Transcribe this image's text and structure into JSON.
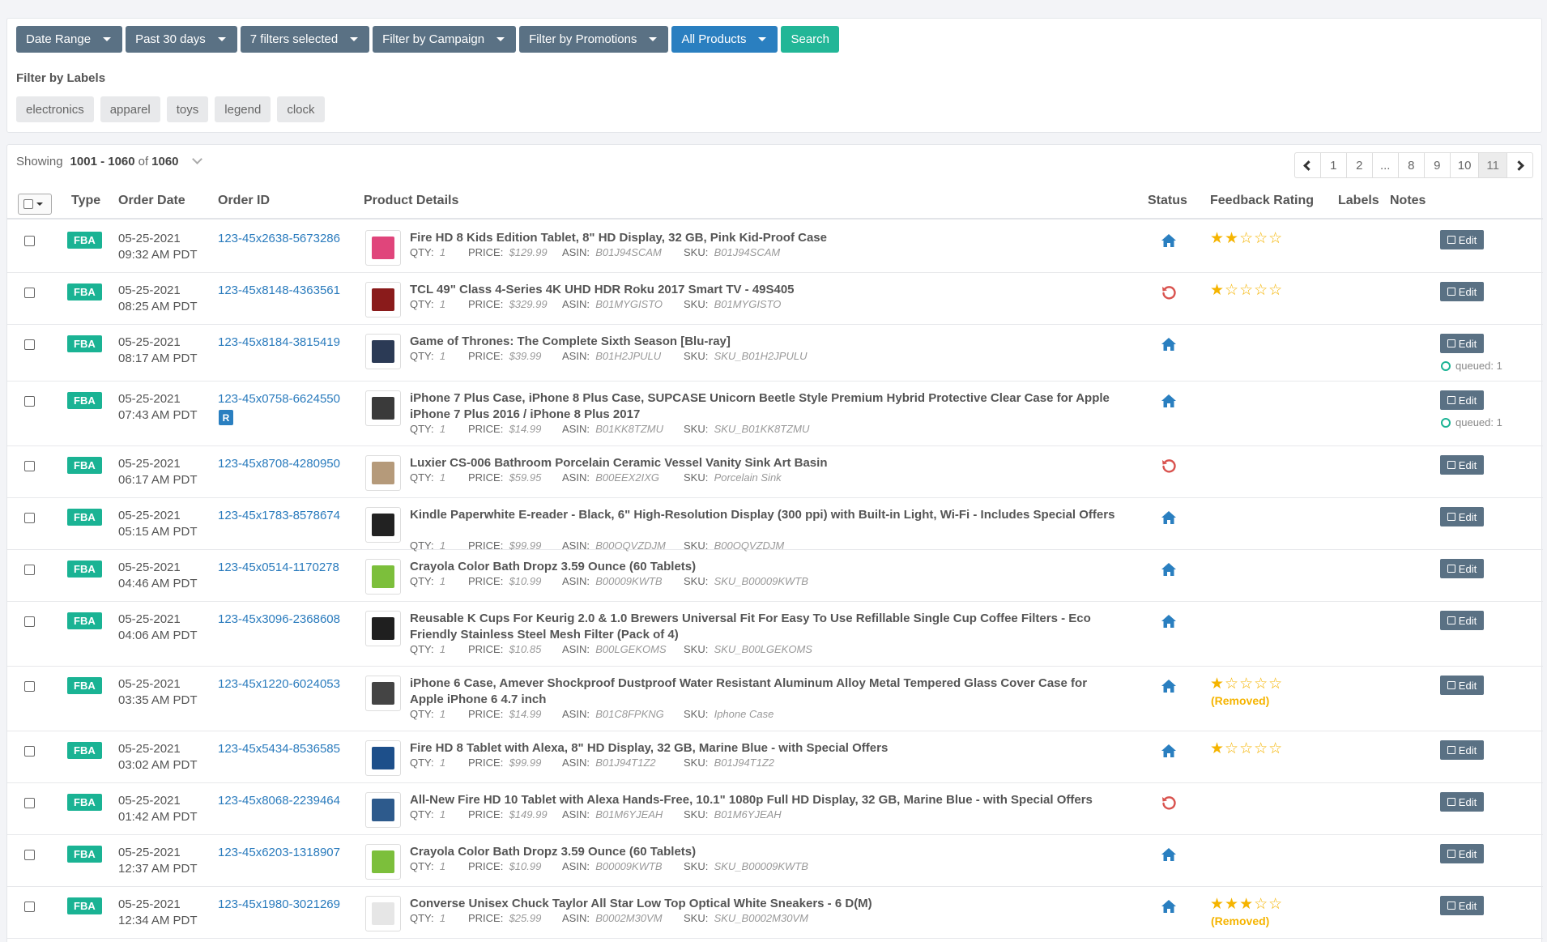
{
  "filters": {
    "buttons": [
      "Date Range",
      "Past 30 days",
      "7 filters selected",
      "Filter by Campaign",
      "Filter by Promotions",
      "All Products"
    ],
    "search_label": "Search",
    "labels_title": "Filter by Labels",
    "labels": [
      "electronics",
      "apparel",
      "toys",
      "legend",
      "clock"
    ]
  },
  "summary": {
    "showing_label": "Showing",
    "range": "1001 - 1060",
    "of_label": "of",
    "total": "1060"
  },
  "pagination": {
    "pages": [
      "1",
      "2",
      "...",
      "8",
      "9",
      "10",
      "11"
    ],
    "active": "11"
  },
  "table": {
    "headers": {
      "type": "Type",
      "order_date": "Order Date",
      "order_id": "Order ID",
      "product": "Product Details",
      "status": "Status",
      "feedback": "Feedback Rating",
      "labels": "Labels",
      "notes": "Notes"
    },
    "meta_labels": {
      "qty": "QTY:",
      "price": "PRICE:",
      "asin": "ASIN:",
      "sku": "SKU:"
    },
    "edit_label": "Edit",
    "rows": [
      {
        "type": "FBA",
        "date": "05-25-2021",
        "time": "09:32 AM PDT",
        "order_id": "123-45x2638-5673286",
        "title": "Fire HD 8 Kids Edition Tablet, 8\" HD Display, 32 GB, Pink Kid-Proof Case",
        "qty": "1",
        "price": "$129.99",
        "asin": "B01J94SCAM",
        "sku": "B01J94SCAM",
        "status": "home-icon",
        "stars": 2,
        "removed": "",
        "queued": "",
        "r": false,
        "thumb_color": "#e0457b"
      },
      {
        "type": "FBA",
        "date": "05-25-2021",
        "time": "08:25 AM PDT",
        "order_id": "123-45x8148-4363561",
        "title": "TCL 49\" Class 4-Series 4K UHD HDR Roku 2017 Smart TV - 49S405",
        "qty": "1",
        "price": "$329.99",
        "asin": "B01MYGISTO",
        "sku": "B01MYGISTO",
        "status": "return-icon",
        "stars": 1,
        "removed": "",
        "queued": "",
        "r": false,
        "thumb_color": "#8a1b1b"
      },
      {
        "type": "FBA",
        "date": "05-25-2021",
        "time": "08:17 AM PDT",
        "order_id": "123-45x8184-3815419",
        "title": "Game of Thrones: The Complete Sixth Season [Blu-ray]",
        "qty": "1",
        "price": "$39.99",
        "asin": "B01H2JPULU",
        "sku": "SKU_B01H2JPULU",
        "status": "home-icon",
        "stars": 0,
        "removed": "",
        "queued": "queued: 1",
        "r": false,
        "thumb_color": "#2b3a55"
      },
      {
        "type": "FBA",
        "date": "05-25-2021",
        "time": "07:43 AM PDT",
        "order_id": "123-45x0758-6624550",
        "title": "iPhone 7 Plus Case, iPhone 8 Plus Case, SUPCASE Unicorn Beetle Style Premium Hybrid Protective Clear Case for Apple iPhone 7 Plus 2016 / iPhone 8 Plus 2017",
        "qty": "1",
        "price": "$14.99",
        "asin": "B01KK8TZMU",
        "sku": "SKU_B01KK8TZMU",
        "status": "home-icon",
        "stars": 0,
        "removed": "",
        "queued": "queued: 1",
        "r": true,
        "r_label": "R",
        "thumb_color": "#3a3a3a"
      },
      {
        "type": "FBA",
        "date": "05-25-2021",
        "time": "06:17 AM PDT",
        "order_id": "123-45x8708-4280950",
        "title": "Luxier CS-006 Bathroom Porcelain Ceramic Vessel Vanity Sink Art Basin",
        "qty": "1",
        "price": "$59.95",
        "asin": "B00EEX2IXG",
        "sku": "Porcelain Sink",
        "status": "return-icon",
        "stars": 0,
        "removed": "",
        "queued": "",
        "r": false,
        "thumb_color": "#b59a7a"
      },
      {
        "type": "FBA",
        "date": "05-25-2021",
        "time": "05:15 AM PDT",
        "order_id": "123-45x1783-8578674",
        "title": "Kindle Paperwhite E-reader - Black, 6\" High-Resolution Display (300 ppi) with Built-in Light, Wi-Fi - Includes Special Offers",
        "qty": "1",
        "price": "$99.99",
        "asin": "B00OQVZDJM",
        "sku": "B00OQVZDJM",
        "status": "home-icon",
        "stars": 0,
        "removed": "",
        "queued": "",
        "r": false,
        "thumb_color": "#222222"
      },
      {
        "type": "FBA",
        "date": "05-25-2021",
        "time": "04:46 AM PDT",
        "order_id": "123-45x0514-1170278",
        "title": "Crayola Color Bath Dropz 3.59 Ounce (60 Tablets)",
        "qty": "1",
        "price": "$10.99",
        "asin": "B00009KWTB",
        "sku": "SKU_B00009KWTB",
        "status": "home-icon",
        "stars": 0,
        "removed": "",
        "queued": "",
        "r": false,
        "thumb_color": "#7cbf3b"
      },
      {
        "type": "FBA",
        "date": "05-25-2021",
        "time": "04:06 AM PDT",
        "order_id": "123-45x3096-2368608",
        "title": "Reusable K Cups For Keurig 2.0 & 1.0 Brewers Universal Fit For Easy To Use Refillable Single Cup Coffee Filters - Eco Friendly Stainless Steel Mesh Filter (Pack of 4)",
        "qty": "1",
        "price": "$10.85",
        "asin": "B00LGEKOMS",
        "sku": "SKU_B00LGEKOMS",
        "status": "home-icon",
        "stars": 0,
        "removed": "",
        "queued": "",
        "r": false,
        "thumb_color": "#1f1f1f"
      },
      {
        "type": "FBA",
        "date": "05-25-2021",
        "time": "03:35 AM PDT",
        "order_id": "123-45x1220-6024053",
        "title": "iPhone 6 Case, Amever Shockproof Dustproof Water Resistant Aluminum Alloy Metal Tempered Glass Cover Case for Apple iPhone 6 4.7 inch",
        "qty": "1",
        "price": "$14.99",
        "asin": "B01C8FPKNG",
        "sku": "Iphone Case",
        "status": "home-icon",
        "stars": 1,
        "removed": "(Removed)",
        "queued": "",
        "r": false,
        "thumb_color": "#444444"
      },
      {
        "type": "FBA",
        "date": "05-25-2021",
        "time": "03:02 AM PDT",
        "order_id": "123-45x5434-8536585",
        "title": "Fire HD 8 Tablet with Alexa, 8\" HD Display, 32 GB, Marine Blue - with Special Offers",
        "qty": "1",
        "price": "$99.99",
        "asin": "B01J94T1Z2",
        "sku": "B01J94T1Z2",
        "status": "home-icon",
        "stars": 1,
        "removed": "",
        "queued": "",
        "r": false,
        "thumb_color": "#1d4f8a"
      },
      {
        "type": "FBA",
        "date": "05-25-2021",
        "time": "01:42 AM PDT",
        "order_id": "123-45x8068-2239464",
        "title": "All-New Fire HD 10 Tablet with Alexa Hands-Free, 10.1\" 1080p Full HD Display, 32 GB, Marine Blue - with Special Offers",
        "qty": "1",
        "price": "$149.99",
        "asin": "B01M6YJEAH",
        "sku": "B01M6YJEAH",
        "status": "return-icon",
        "stars": 0,
        "removed": "",
        "queued": "",
        "r": false,
        "thumb_color": "#2d5a8c"
      },
      {
        "type": "FBA",
        "date": "05-25-2021",
        "time": "12:37 AM PDT",
        "order_id": "123-45x6203-1318907",
        "title": "Crayola Color Bath Dropz 3.59 Ounce (60 Tablets)",
        "qty": "1",
        "price": "$10.99",
        "asin": "B00009KWTB",
        "sku": "SKU_B00009KWTB",
        "status": "home-icon",
        "stars": 0,
        "removed": "",
        "queued": "",
        "r": false,
        "thumb_color": "#7cbf3b"
      },
      {
        "type": "FBA",
        "date": "05-25-2021",
        "time": "12:34 AM PDT",
        "order_id": "123-45x1980-3021269",
        "title": "Converse Unisex Chuck Taylor All Star Low Top Optical White Sneakers - 6 D(M)",
        "qty": "1",
        "price": "$25.99",
        "asin": "B0002M30VM",
        "sku": "SKU_B0002M30VM",
        "status": "home-icon",
        "stars": 3,
        "removed": "(Removed)",
        "queued": "",
        "r": false,
        "thumb_color": "#e6e6e6"
      }
    ]
  },
  "colors": {
    "accent": "#2a7fc0",
    "fba": "#1ab394",
    "button": "#5a7184",
    "star": "#f5b400",
    "return": "#d9534f",
    "home": "#2a7fc0"
  }
}
